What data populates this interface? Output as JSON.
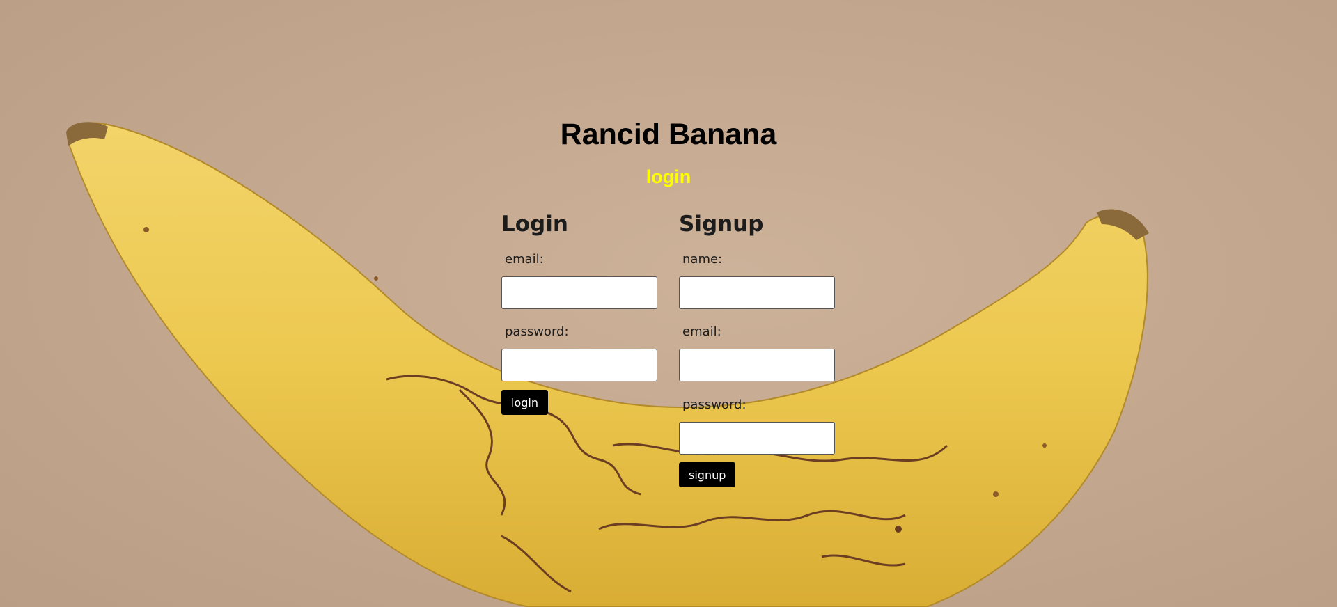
{
  "site": {
    "title": "Rancid Banana",
    "nav_link": "login",
    "link_color": "#ffff00"
  },
  "login_form": {
    "heading": "Login",
    "email_label": "email:",
    "email_value": "",
    "password_label": "password:",
    "password_value": "",
    "submit_label": "login"
  },
  "signup_form": {
    "heading": "Signup",
    "name_label": "name:",
    "name_value": "",
    "email_label": "email:",
    "email_value": "",
    "password_label": "password:",
    "password_value": "",
    "submit_label": "signup"
  },
  "background": {
    "image": "banana-photo",
    "color": "#c4a990"
  }
}
